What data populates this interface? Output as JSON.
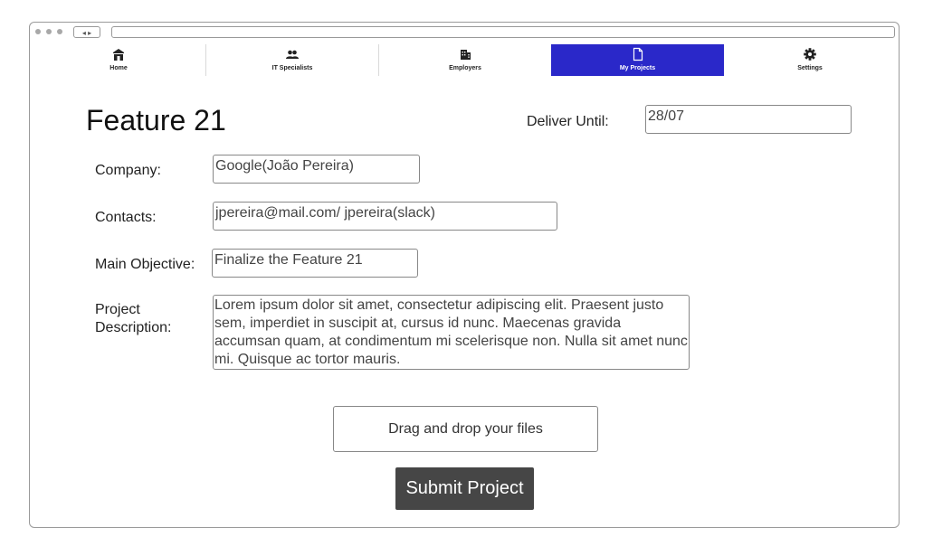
{
  "nav": {
    "items": [
      {
        "label": "Home",
        "icon": "home-icon"
      },
      {
        "label": "IT Specialists",
        "icon": "people-icon"
      },
      {
        "label": "Employers",
        "icon": "building-icon"
      },
      {
        "label": "My Projects",
        "icon": "document-icon",
        "active": true
      },
      {
        "label": "Settings",
        "icon": "gear-icon"
      }
    ],
    "active_color": "#2a28c9"
  },
  "page": {
    "title": "Feature 21",
    "deliver_label": "Deliver Until:",
    "deliver_value": "28/07"
  },
  "form": {
    "company_label": "Company:",
    "company_value": "Google(João Pereira)",
    "contacts_label": "Contacts:",
    "contacts_value": "jpereira@mail.com/ jpereira(slack)",
    "objective_label": "Main Objective:",
    "objective_value": "Finalize the Feature 21",
    "description_label_1": "Project",
    "description_label_2": "Description:",
    "description_value": "Lorem ipsum dolor sit amet, consectetur adipiscing elit. Praesent justo sem, imperdiet in suscipit at, cursus id nunc. Maecenas gravida accumsan quam, at condimentum mi scelerisque non. Nulla sit amet nunc mi. Quisque ac tortor mauris."
  },
  "upload": {
    "label": "Drag and drop your files"
  },
  "submit": {
    "label": "Submit Project",
    "color": "#464646"
  }
}
